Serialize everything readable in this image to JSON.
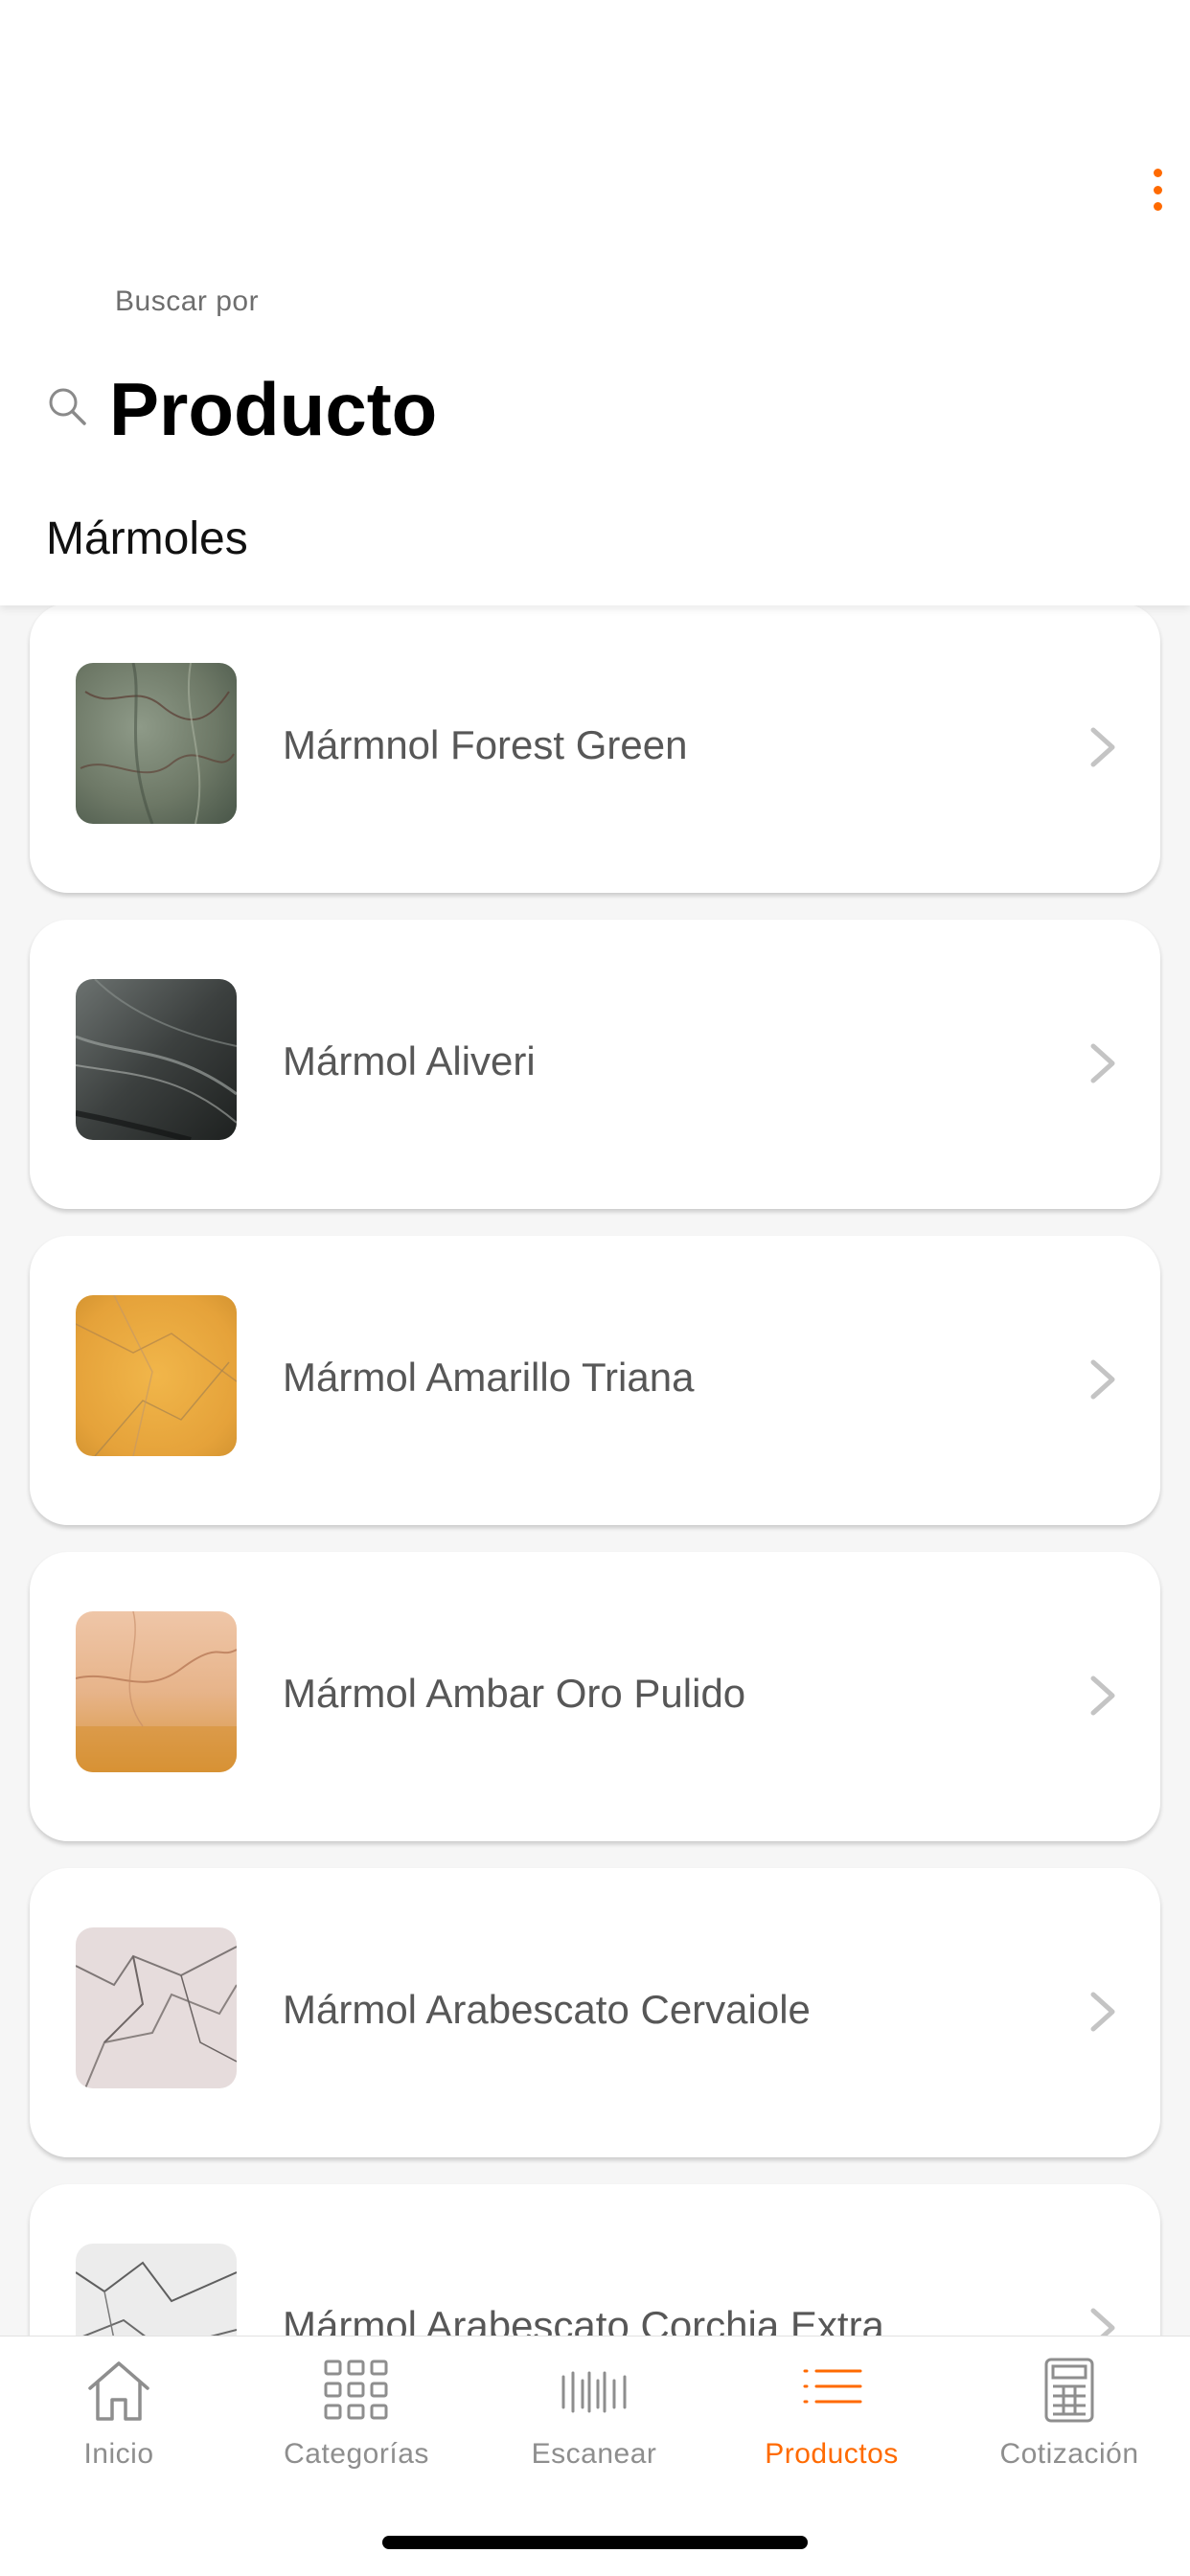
{
  "header": {
    "subtitle": "Buscar por",
    "title": "Producto",
    "section": "Mármoles",
    "accent_color": "#ff6a00",
    "menu_icon": "more-vertical-icon",
    "search_icon": "search-icon"
  },
  "products": [
    {
      "name": "Mármnol Forest Green",
      "swatch": "forest-green"
    },
    {
      "name": "Mármol Aliveri",
      "swatch": "aliveri"
    },
    {
      "name": "Mármol Amarillo Triana",
      "swatch": "amarillo"
    },
    {
      "name": "Mármol Ambar Oro Pulido",
      "swatch": "ambar"
    },
    {
      "name": "Mármol Arabescato Cervaiole",
      "swatch": "cervaiole"
    },
    {
      "name": "Mármol Arabescato Corchia Extra",
      "swatch": "corchia"
    }
  ],
  "tabs": [
    {
      "label": "Inicio",
      "icon": "home-icon",
      "active": false
    },
    {
      "label": "Categorías",
      "icon": "grid-icon",
      "active": false
    },
    {
      "label": "Escanear",
      "icon": "barcode-icon",
      "active": false
    },
    {
      "label": "Productos",
      "icon": "list-icon",
      "active": true
    },
    {
      "label": "Cotización",
      "icon": "calculator-icon",
      "active": false
    }
  ]
}
